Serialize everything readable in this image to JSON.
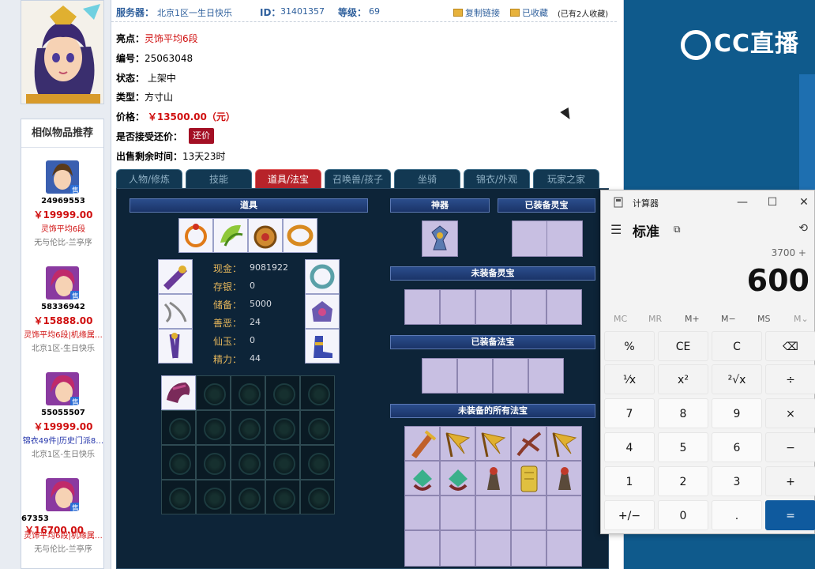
{
  "header": {
    "server_label": "服务器：",
    "server_value": "北京1区一生日快乐",
    "id_label": "ID：",
    "id_value": "31401357",
    "level_label": "等级：",
    "level_value": "69",
    "copy_link": "复制链接",
    "favorited": "已收藏",
    "fav_count_text": "(已有2人收藏)"
  },
  "info": {
    "highlight_label": "亮点：",
    "highlight_value": "灵饰平均6段",
    "number_label": "编号：",
    "number_value": "25063048",
    "status_label": "状态：",
    "status_value": "上架中",
    "type_label": "类型：",
    "type_value": "方寸山",
    "price_label": "价格：",
    "price_value": "￥13500.00（元）",
    "counter_label": "是否接受还价：",
    "counter_button": "还价",
    "remaining_label": "出售剩余时间：",
    "remaining_value": "13天23时"
  },
  "recommend": {
    "title": "相似物品推荐",
    "sell_tag": "售",
    "items": [
      {
        "id": "24969553",
        "price": "￥19999.00",
        "tag": "灵饰平均6段",
        "tag_color": "#d01010",
        "server": "无与伦比-兰亭序"
      },
      {
        "id": "58336942",
        "price": "￥15888.00",
        "tag": "灵饰平均6段|机缘属…",
        "tag_color": "#d01010",
        "server": "北京1区-生日快乐"
      },
      {
        "id": "55055507",
        "price": "￥19999.00",
        "tag": "锦衣49件|历史门派8…",
        "tag_color": "#2233aa",
        "server": "北京1区-生日快乐"
      },
      {
        "id": "67353",
        "price": "￥16700.00",
        "tag": "灵饰平均6段|机缘属…",
        "tag_color": "#d01010",
        "server": "无与伦比-兰亭序"
      }
    ]
  },
  "tabs": [
    "人物/修炼",
    "技能",
    "道具/法宝",
    "召唤兽/孩子",
    "坐骑",
    "锦衣/外观",
    "玩家之家"
  ],
  "panel": {
    "props_title": "道具",
    "artifact_title": "神器",
    "equipped_soul_title": "已装备灵宝",
    "unequipped_soul_title": "未装备灵宝",
    "equipped_magic_title": "已装备法宝",
    "all_magic_title": "未装备的所有法宝",
    "stats": [
      {
        "label": "现金：",
        "value": "9081922"
      },
      {
        "label": "存银：",
        "value": "0"
      },
      {
        "label": "储备：",
        "value": "5000"
      },
      {
        "label": "善恶：",
        "value": "24"
      },
      {
        "label": "仙玉：",
        "value": "0"
      },
      {
        "label": "精力：",
        "value": "44"
      }
    ]
  },
  "calculator": {
    "title": "计算器",
    "mode": "标准",
    "expression": "3700 +",
    "display": "600",
    "memory": [
      "MC",
      "MR",
      "M+",
      "M−",
      "MS",
      "M⌄"
    ],
    "keys": [
      "%",
      "CE",
      "C",
      "⌫",
      "⅟x",
      "x²",
      "²√x",
      "÷",
      "7",
      "8",
      "9",
      "×",
      "4",
      "5",
      "6",
      "−",
      "1",
      "2",
      "3",
      "+",
      "+/−",
      "0",
      ".",
      "="
    ]
  },
  "brand": {
    "logo_text": "CC直播"
  }
}
